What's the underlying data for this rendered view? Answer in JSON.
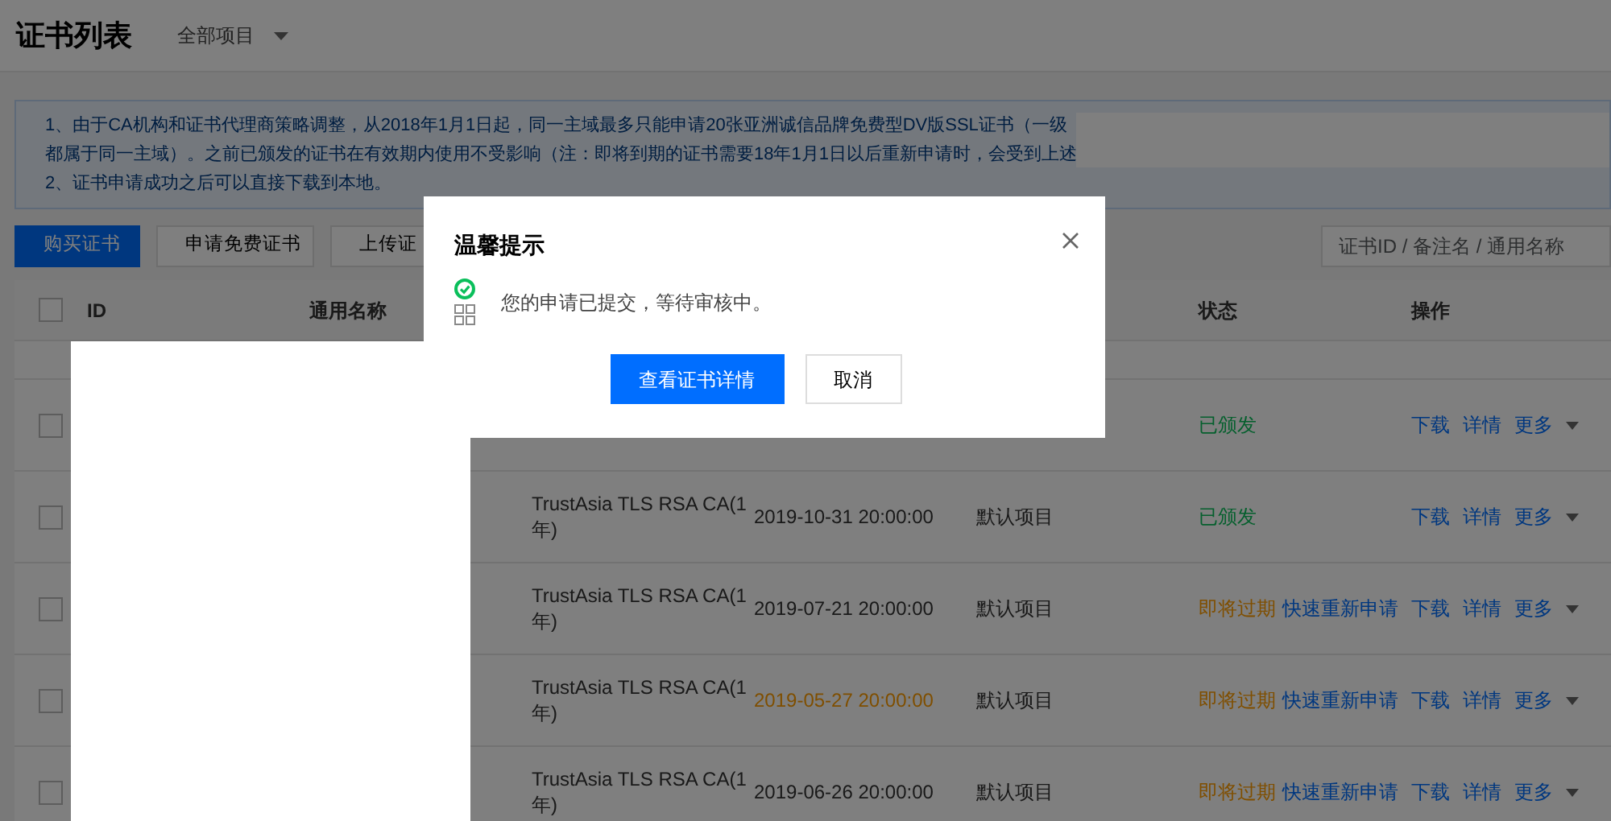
{
  "header": {
    "title": "证书列表",
    "project_filter": "全部项目"
  },
  "notice": {
    "lines": [
      "1、由于CA机构和证书代理商策略调整，从2018年1月1日起，同一主域最多只能申请20张亚洲诚信品牌免费型DV版SSL证书（一级",
      "都属于同一主域）。之前已颁发的证书在有效期内使用不受影响（注：即将到期的证书需要18年1月1日以后重新申请时，会受到上述",
      "2、证书申请成功之后可以直接下载到本地。"
    ]
  },
  "toolbar": {
    "buttons": [
      {
        "label": "购买证书",
        "primary": true
      },
      {
        "label": "申请免费证书",
        "primary": false
      },
      {
        "label": "上传证",
        "primary": false
      }
    ],
    "search": {
      "placeholder": "证书ID / 备注名 / 通用名称"
    }
  },
  "table": {
    "columns": [
      "ID",
      "通用名称",
      "状态",
      "操作"
    ],
    "select_all_checked": false,
    "rows": [
      {
        "checked": false,
        "ca": "",
        "expiry": "",
        "project": "",
        "status": {
          "kind": "issued",
          "label": "已颁发"
        },
        "actions": [
          "下载",
          "详情",
          "更多"
        ]
      },
      {
        "checked": false,
        "ca": "TrustAsia TLS RSA CA(1年)",
        "expiry": "2019-10-31 20:00:00",
        "date_warning": false,
        "project": "默认项目",
        "status": {
          "kind": "issued",
          "label": "已颁发"
        },
        "actions": [
          "下载",
          "详情",
          "更多"
        ]
      },
      {
        "checked": false,
        "ca": "TrustAsia TLS RSA CA(1年)",
        "expiry": "2019-07-21 20:00:00",
        "date_warning": false,
        "project": "默认项目",
        "status": {
          "kind": "expiring",
          "label": "即将过期",
          "renew": "快速重新申请"
        },
        "actions": [
          "下载",
          "详情",
          "更多"
        ]
      },
      {
        "checked": false,
        "ca": "TrustAsia TLS RSA CA(1年)",
        "expiry": "2019-05-27 20:00:00",
        "date_warning": true,
        "project": "默认项目",
        "status": {
          "kind": "expiring",
          "label": "即将过期",
          "renew": "快速重新申请"
        },
        "actions": [
          "下载",
          "详情",
          "更多"
        ]
      },
      {
        "checked": false,
        "ca": "TrustAsia TLS RSA CA(1年)",
        "expiry": "2019-06-26 20:00:00",
        "date_warning": false,
        "project": "默认项目",
        "status": {
          "kind": "expiring",
          "label": "即将过期",
          "renew": "快速重新申请"
        },
        "actions": [
          "下载",
          "详情",
          "更多"
        ]
      }
    ]
  },
  "dialog": {
    "title": "温馨提示",
    "message": "您的申请已提交，等待审核中。",
    "buttons": [
      {
        "label": "查看证书详情",
        "primary": true
      },
      {
        "label": "取消",
        "primary": false
      }
    ]
  }
}
